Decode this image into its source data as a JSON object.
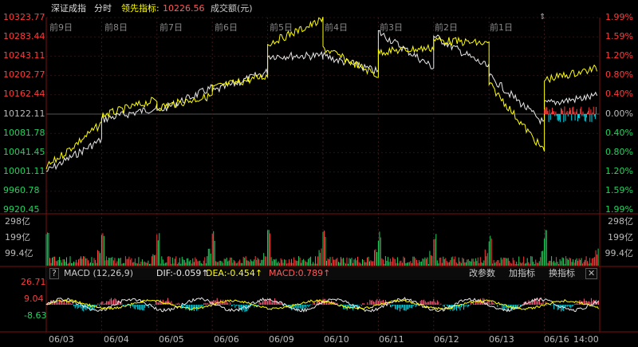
{
  "header": {
    "index_name": "深证成指",
    "period": "分时",
    "indicator_label": "领先指标:",
    "indicator_value": "10226.56",
    "volume_label": "成交额(元)"
  },
  "colors": {
    "up": "#ff3b3b",
    "down": "#23d160",
    "white_line": "#e8e8e8",
    "yellow_line": "#ffff00",
    "cyan": "#00d8e8",
    "macd_pink": "#ff5a78"
  },
  "price_axis": {
    "left": [
      "10323.77",
      "10283.44",
      "10243.11",
      "10202.77",
      "10162.44",
      "10122.11",
      "10081.78",
      "10041.45",
      "10001.11",
      "9960.78",
      "9920.45"
    ],
    "right": [
      "1.99%",
      "1.59%",
      "1.20%",
      "0.80%",
      "0.40%",
      "0.00%",
      "0.40%",
      "0.80%",
      "1.20%",
      "1.59%",
      "1.99%"
    ]
  },
  "day_labels": [
    "前9日",
    "前8日",
    "前7日",
    "前6日",
    "前5日",
    "前4日",
    "前3日",
    "前2日",
    "前1日"
  ],
  "volume_axis": {
    "left": [
      "298亿",
      "199亿",
      "99.4亿"
    ],
    "right": [
      "298亿",
      "199亿",
      "99.4亿"
    ]
  },
  "macd": {
    "help": "?",
    "name": "MACD (12,26,9)",
    "dif": "DIF:-0.059↑",
    "dea": "DEA:-0.454↑",
    "macd": "MACD:0.789↑",
    "params_btn": "改参数",
    "add_btn": "加指标",
    "switch_btn": "换指标",
    "close_btn": "✕",
    "axis": [
      "26.71",
      "9.04",
      "-8.63"
    ]
  },
  "dates": [
    "06/03",
    "06/04",
    "06/05",
    "06/06",
    "06/09",
    "06/10",
    "06/11",
    "06/12",
    "06/13",
    "06/16",
    "14:00"
  ]
}
